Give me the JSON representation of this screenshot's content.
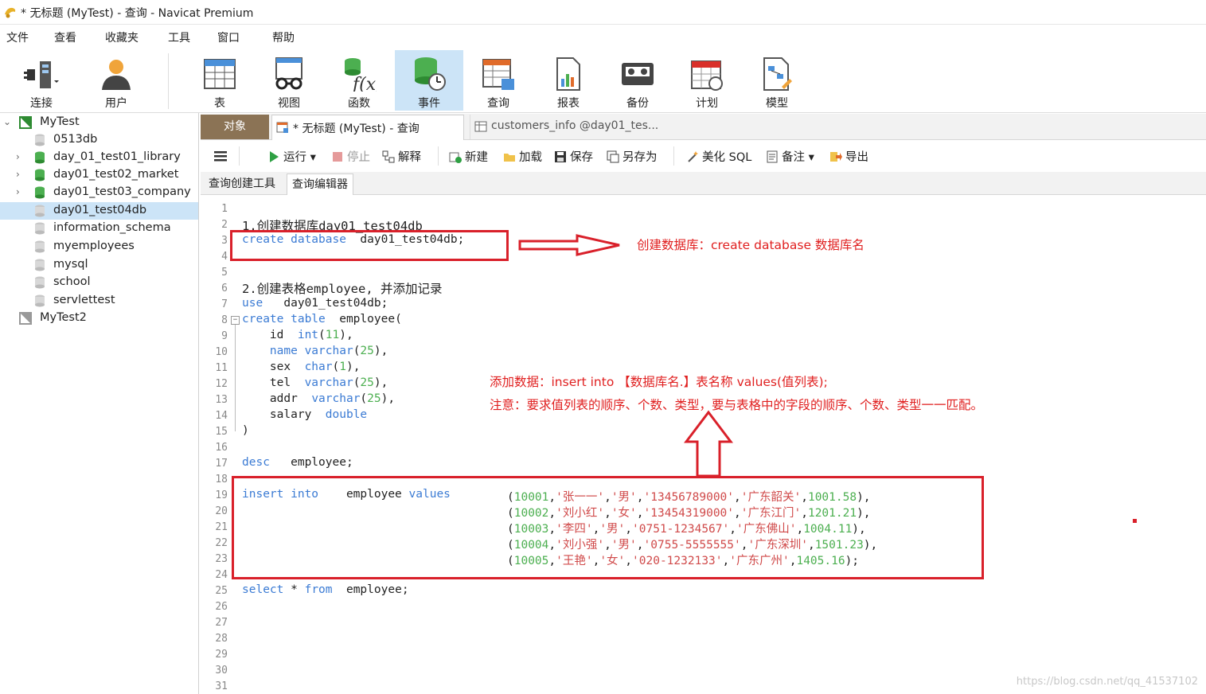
{
  "window": {
    "title": "* 无标题 (MyTest) - 查询 - Navicat Premium"
  },
  "menu": [
    "文件",
    "查看",
    "收藏夹",
    "工具",
    "窗口",
    "帮助"
  ],
  "ribbon": {
    "connect": "连接",
    "user": "用户",
    "table": "表",
    "view": "视图",
    "function": "函数",
    "event": "事件",
    "query": "查询",
    "report": "报表",
    "backup": "备份",
    "schedule": "计划",
    "model": "模型"
  },
  "sidebar": {
    "conn1": "MyTest",
    "dbs": [
      "0513db",
      "day_01_test01_library",
      "day01_test02_market",
      "day01_test03_company",
      "day01_test04db",
      "information_schema",
      "myemployees",
      "mysql",
      "school",
      "servlettest"
    ],
    "conn2": "MyTest2"
  },
  "tabs": {
    "objects": "对象",
    "query": "* 无标题 (MyTest) - 查询",
    "customers": "customers_info @day01_tes..."
  },
  "toolbar": {
    "run": "运行",
    "stop": "停止",
    "explain": "解释",
    "new": "新建",
    "load": "加载",
    "save": "保存",
    "save_as": "另存为",
    "beautify": "美化 SQL",
    "note": "备注",
    "export": "导出"
  },
  "subtabs": {
    "builder": "查询创建工具",
    "editor": "查询编辑器"
  },
  "code": {
    "l2": "1.创建数据库day01_test04db",
    "l3_kw": "create database",
    "l3_rest": "  day01_test04db;",
    "l6": "2.创建表格employee, 并添加记录",
    "l7_kw": "use",
    "l7_rest": "   day01_test04db;",
    "l8_kw": "create table",
    "l8_rest": "  employee(",
    "l9_a": "    id  ",
    "l9_kw": "int",
    "l9_p1": "(",
    "l9_n": "11",
    "l9_p2": "),",
    "l10_a": "    ",
    "l10_kw1": "name",
    "l10_sp": " ",
    "l10_kw2": "varchar",
    "l10_p1": "(",
    "l10_n": "25",
    "l10_p2": "),",
    "l11_a": "    sex  ",
    "l11_kw": "char",
    "l11_p1": "(",
    "l11_n": "1",
    "l11_p2": "),",
    "l12_a": "    tel  ",
    "l12_kw": "varchar",
    "l12_p1": "(",
    "l12_n": "25",
    "l12_p2": "),",
    "l13_a": "    addr  ",
    "l13_kw": "varchar",
    "l13_p1": "(",
    "l13_n": "25",
    "l13_p2": "),",
    "l14_a": "    salary  ",
    "l14_kw": "double",
    "l15": ")",
    "l17_kw": "desc",
    "l17_rest": "   employee;",
    "l19_kw1": "insert into",
    "l19_mid": "    employee ",
    "l19_kw2": "values",
    "l25_kw1": "select",
    "l25_mid": " * ",
    "l25_kw2": "from",
    "l25_rest": "  employee;"
  },
  "rows": [
    {
      "id": "10001",
      "name": "'张一一'",
      "sex": "'男'",
      "tel": "'13456789000'",
      "addr": "'广东韶关'",
      "salary": "1001.58",
      "end": "),"
    },
    {
      "id": "10002",
      "name": "'刘小红'",
      "sex": "'女'",
      "tel": "'13454319000'",
      "addr": "'广东江门'",
      "salary": "1201.21",
      "end": "),"
    },
    {
      "id": "10003",
      "name": "'李四'",
      "sex": "'男'",
      "tel": "'0751-1234567'",
      "addr": "'广东佛山'",
      "salary": "1004.11",
      "end": "),"
    },
    {
      "id": "10004",
      "name": "'刘小强'",
      "sex": "'男'",
      "tel": "'0755-5555555'",
      "addr": "'广东深圳'",
      "salary": "1501.23",
      "end": "),"
    },
    {
      "id": "10005",
      "name": "'王艳'",
      "sex": "'女'",
      "tel": "'020-1232133'",
      "addr": "'广东广州'",
      "salary": "1405.16",
      "end": ");"
    }
  ],
  "annotations": {
    "create_db": "创建数据库：create   database  数据库名",
    "insert_syntax": "添加数据：insert  into  【数据库名.】表名称   values(值列表);",
    "insert_note": "注意：要求值列表的顺序、个数、类型，要与表格中的字段的顺序、个数、类型一一匹配。"
  },
  "watermark": "https://blog.csdn.net/qq_41537102",
  "colors": {
    "keyword": "#3b7bd4",
    "number": "#4caf50",
    "string": "#d04a4a",
    "annotation": "#e02020",
    "selection": "#cce4f7",
    "objects_tab": "#8b7355"
  }
}
